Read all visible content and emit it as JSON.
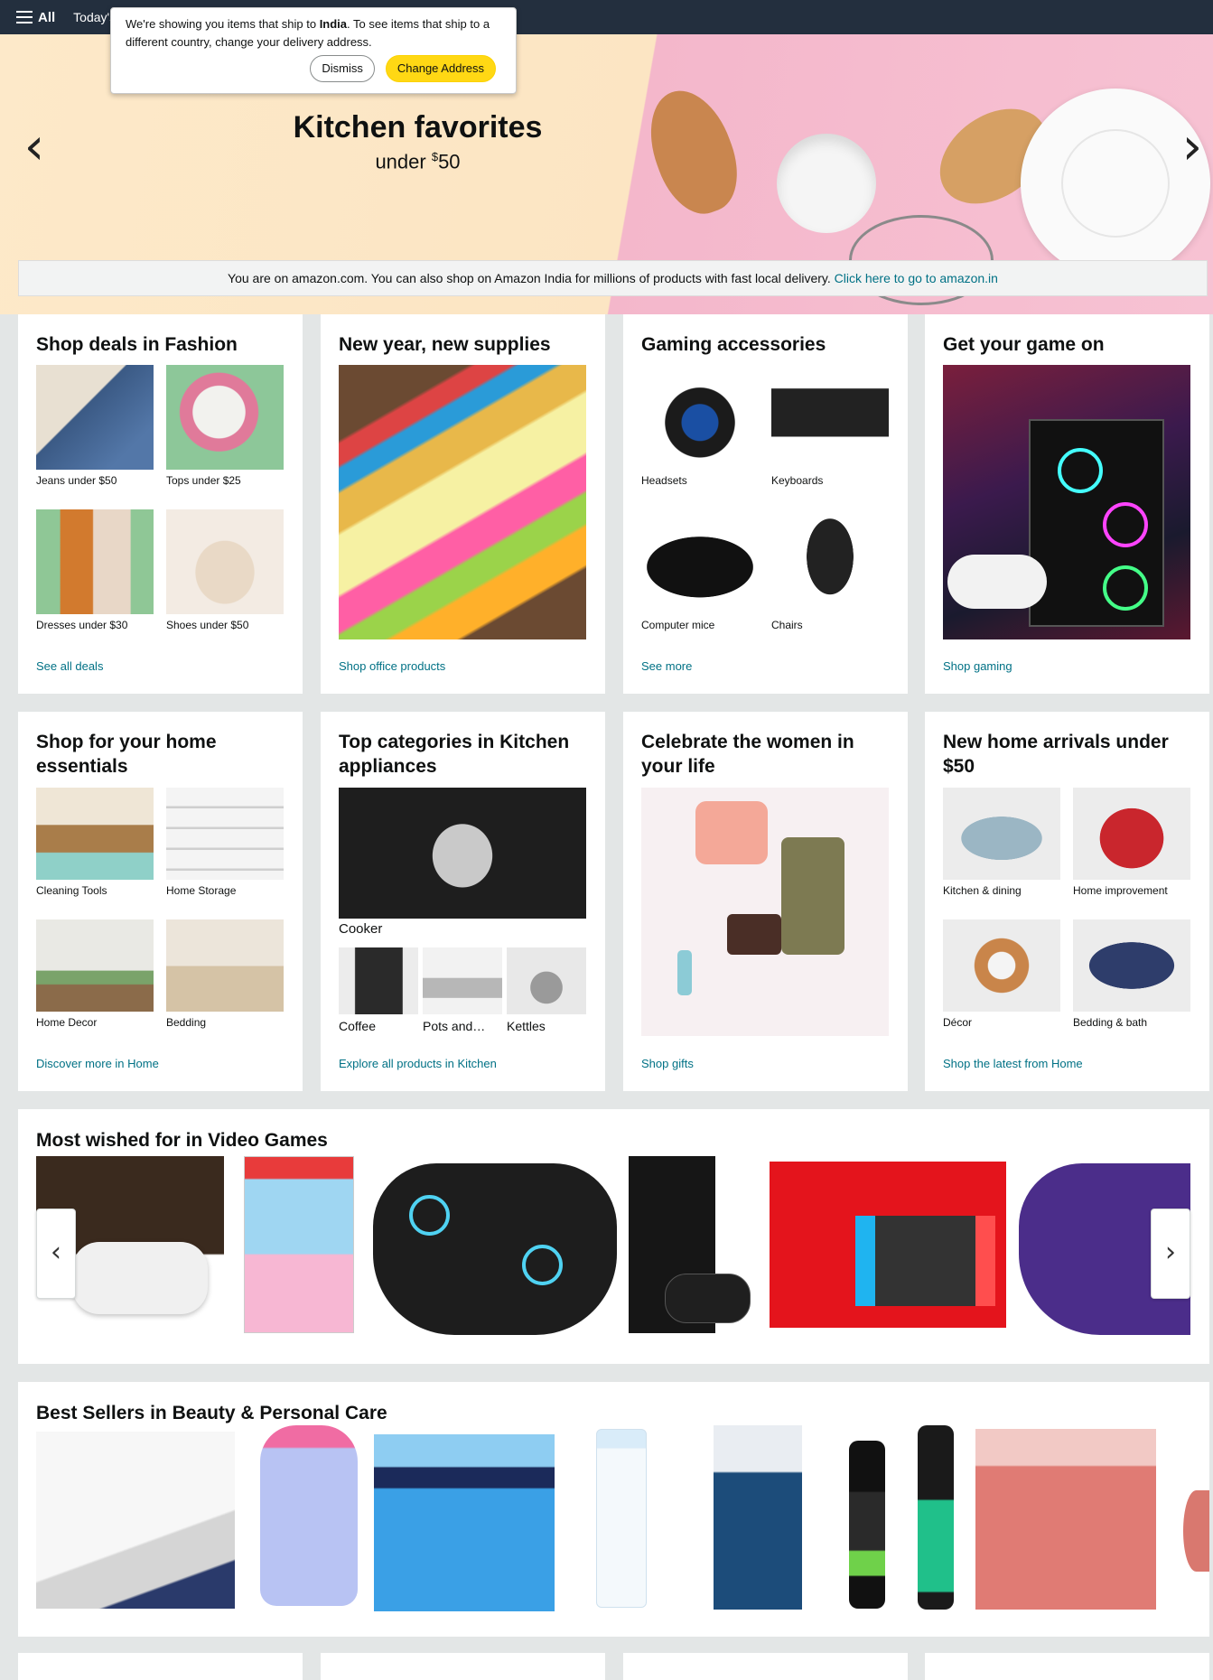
{
  "nav": {
    "all_label": "All",
    "todays_label": "Today's"
  },
  "popover": {
    "text_before": "We're showing you items that ship to ",
    "country": "India",
    "text_after": ". To see items that ship to a different country, change your delivery address.",
    "dismiss_label": "Dismiss",
    "change_label": "Change Address"
  },
  "hero": {
    "title": "Kitchen favorites",
    "subtitle_prefix": "under ",
    "currency": "$",
    "amount": "50"
  },
  "notice": {
    "text": "You are on amazon.com. You can also shop on Amazon India for millions of products with fast local delivery. ",
    "link": "Click here to go to amazon.in"
  },
  "cards_row1": [
    {
      "title": "Shop deals in Fashion",
      "items": [
        "Jeans under $50",
        "Tops under $25",
        "Dresses under $30",
        "Shoes under $50"
      ],
      "link": "See all deals"
    },
    {
      "title": "New year, new supplies",
      "link": "Shop office products"
    },
    {
      "title": "Gaming accessories",
      "items": [
        "Headsets",
        "Keyboards",
        "Computer mice",
        "Chairs"
      ],
      "link": "See more"
    },
    {
      "title": "Get your game on",
      "link": "Shop gaming"
    }
  ],
  "cards_row2": [
    {
      "title": "Shop for your home essentials",
      "items": [
        "Cleaning Tools",
        "Home Storage",
        "Home Decor",
        "Bedding"
      ],
      "link": "Discover more in Home"
    },
    {
      "title": "Top categories in Kitchen appliances",
      "main_item": "Cooker",
      "items": [
        "Coffee",
        "Pots and…",
        "Kettles"
      ],
      "link": "Explore all products in Kitchen"
    },
    {
      "title": "Celebrate the women in your life",
      "link": "Shop gifts"
    },
    {
      "title": "New home arrivals under $50",
      "items": [
        "Kitchen & dining",
        "Home improvement",
        "Décor",
        "Bedding & bath"
      ],
      "link": "Shop the latest from Home"
    }
  ],
  "video_games": {
    "title": "Most wished for in Video Games"
  },
  "beauty": {
    "title": "Best Sellers in Beauty & Personal Care"
  },
  "colors": {
    "nav": "#232f3e",
    "link": "#007185",
    "button_yellow": "#ffd814"
  }
}
